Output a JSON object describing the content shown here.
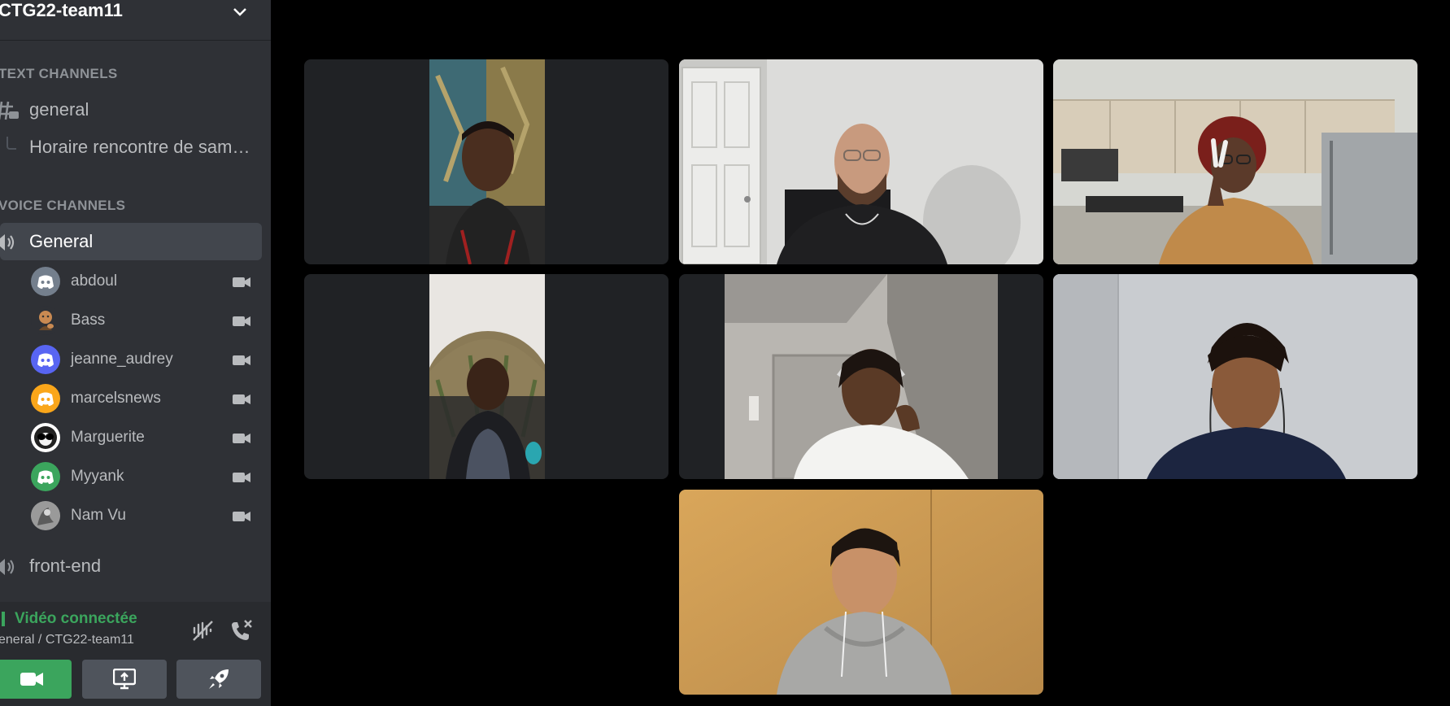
{
  "server": {
    "name": "CTG22-team11"
  },
  "categories": {
    "text": "TEXT CHANNELS",
    "voice": "VOICE CHANNELS"
  },
  "text_channels": [
    {
      "name": "general",
      "icon": "hash-thread-icon"
    },
    {
      "name": "Horaire rencontre de sam…",
      "icon": "thread-branch-icon"
    }
  ],
  "voice_channels": [
    {
      "name": "General",
      "icon": "speaker-icon",
      "active": true
    },
    {
      "name": "front-end",
      "icon": "speaker-icon",
      "active": false
    }
  ],
  "members": [
    {
      "name": "abdoul",
      "avatar": "discord-logo-grey",
      "color": "#747f8d"
    },
    {
      "name": "Bass",
      "avatar": "emoji-avatar",
      "color": "#2f3136"
    },
    {
      "name": "jeanne_audrey",
      "avatar": "discord-logo-blurple",
      "color": "#5865f2"
    },
    {
      "name": "marcelsnews",
      "avatar": "discord-logo-orange",
      "color": "#faa61a"
    },
    {
      "name": "Marguerite",
      "avatar": "sunglasses-avatar",
      "color": "#ffffff"
    },
    {
      "name": "Myyank",
      "avatar": "discord-logo-green",
      "color": "#3ba55d"
    },
    {
      "name": "Nam Vu",
      "avatar": "photo-avatar",
      "color": "#8a8a8a"
    }
  ],
  "voice_status": {
    "title": "Vidéo connectée",
    "subtitle": "eneral / CTG22-team11"
  },
  "colors": {
    "sidebar": "#2f3136",
    "accent_green": "#3ba55d",
    "tile_bg": "#202225",
    "stage_bg": "#000000"
  },
  "video_tiles": [
    {
      "participant": "abdoul",
      "orientation": "portrait"
    },
    {
      "participant": "Bass",
      "orientation": "landscape"
    },
    {
      "participant": "jeanne_audrey",
      "orientation": "landscape"
    },
    {
      "participant": "marcelsnews",
      "orientation": "portrait"
    },
    {
      "participant": "Marguerite",
      "orientation": "landscape-cropped"
    },
    {
      "participant": "Myyank",
      "orientation": "landscape"
    },
    {
      "participant": "Nam Vu",
      "orientation": "landscape"
    }
  ]
}
